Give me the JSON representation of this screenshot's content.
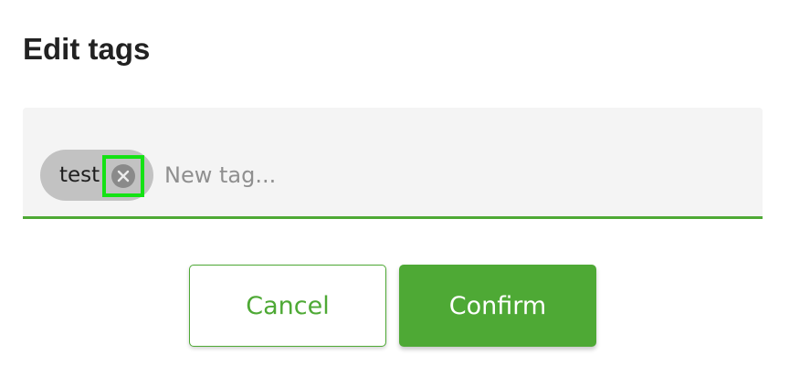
{
  "dialog": {
    "title": "Edit tags"
  },
  "tag_field": {
    "tags": [
      {
        "label": "test",
        "remove_icon": "close-circle-icon"
      }
    ],
    "input_value": "",
    "input_placeholder": "New tag..."
  },
  "actions": {
    "cancel_label": "Cancel",
    "confirm_label": "Confirm"
  },
  "colors": {
    "accent": "#4ea935",
    "field_background": "#f4f4f4",
    "chip_background": "#c2c2c2",
    "remove_icon_background": "#8a8a8a",
    "focus_highlight": "#14e214"
  }
}
